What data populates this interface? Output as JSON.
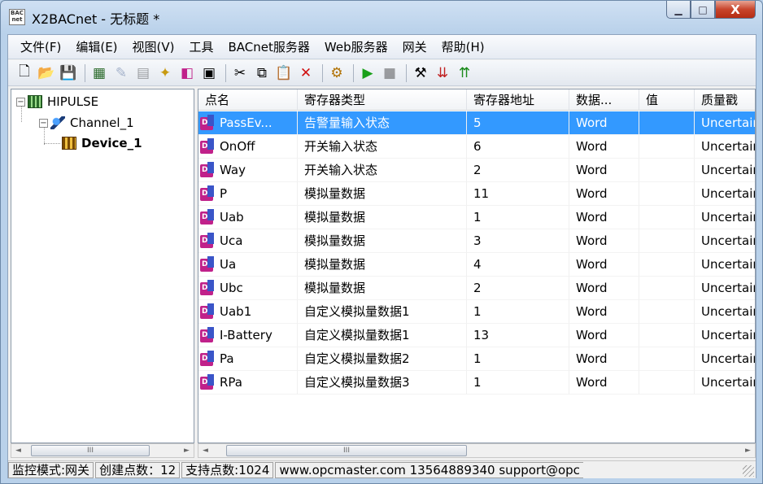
{
  "window": {
    "title": "X2BACnet - 无标题 *",
    "app_icon_lines": [
      "BAC",
      "net"
    ],
    "minimize": "▁",
    "maximize": "□",
    "close": "X"
  },
  "menu": [
    "文件(F)",
    "编辑(E)",
    "视图(V)",
    "工具",
    "BACnet服务器",
    "Web服务器",
    "网关",
    "帮助(H)"
  ],
  "tree": {
    "root": "HIPULSE",
    "channel": "Channel_1",
    "device": "Device_1",
    "collapse_glyph": "−"
  },
  "columns": [
    "点名",
    "寄存器类型",
    "寄存器地址",
    "数据...",
    "值",
    "质量戳"
  ],
  "rows": [
    {
      "name": "PassEv...",
      "type": "告警量输入状态",
      "addr": "5",
      "data": "Word",
      "value": "",
      "quality": "Uncertain",
      "selected": true
    },
    {
      "name": "OnOff",
      "type": "开关输入状态",
      "addr": "6",
      "data": "Word",
      "value": "",
      "quality": "Uncertain"
    },
    {
      "name": "Way",
      "type": "开关输入状态",
      "addr": "2",
      "data": "Word",
      "value": "",
      "quality": "Uncertain"
    },
    {
      "name": "P",
      "type": "模拟量数据",
      "addr": "11",
      "data": "Word",
      "value": "",
      "quality": "Uncertain"
    },
    {
      "name": "Uab",
      "type": "模拟量数据",
      "addr": "1",
      "data": "Word",
      "value": "",
      "quality": "Uncertain"
    },
    {
      "name": "Uca",
      "type": "模拟量数据",
      "addr": "3",
      "data": "Word",
      "value": "",
      "quality": "Uncertain"
    },
    {
      "name": "Ua",
      "type": "模拟量数据",
      "addr": "4",
      "data": "Word",
      "value": "",
      "quality": "Uncertain"
    },
    {
      "name": "Ubc",
      "type": "模拟量数据",
      "addr": "2",
      "data": "Word",
      "value": "",
      "quality": "Uncertain"
    },
    {
      "name": "Uab1",
      "type": "自定义模拟量数据1",
      "addr": "1",
      "data": "Word",
      "value": "",
      "quality": "Uncertain"
    },
    {
      "name": "I-Battery",
      "type": "自定义模拟量数据1",
      "addr": "13",
      "data": "Word",
      "value": "",
      "quality": "Uncertain"
    },
    {
      "name": "Pa",
      "type": "自定义模拟量数据2",
      "addr": "1",
      "data": "Word",
      "value": "",
      "quality": "Uncertain"
    },
    {
      "name": "RPa",
      "type": "自定义模拟量数据3",
      "addr": "1",
      "data": "Word",
      "value": "",
      "quality": "Uncertain"
    }
  ],
  "point_icon_text": "D",
  "scroll": {
    "left": "◄",
    "right": "►",
    "thumb": "III"
  },
  "status": {
    "mode": "监控模式:网关",
    "created": "创建点数：12",
    "supported": "支持点数:1024",
    "contact": "www.opcmaster.com 13564889340 support@opc"
  },
  "colors": {
    "selection": "#3399ff",
    "close_button": "#c8452c",
    "frame": "#b9d1ea"
  },
  "toolbar_icons": [
    "new-icon",
    "open-icon",
    "save-icon",
    "add-server-icon",
    "add-channel-icon",
    "add-device-icon",
    "add-point-icon",
    "import-icon",
    "properties-icon",
    "cut-icon",
    "copy-icon",
    "paste-icon",
    "delete-icon",
    "tags-icon",
    "run-icon",
    "stop-icon",
    "tools-icon",
    "load-icon",
    "upload-icon"
  ]
}
